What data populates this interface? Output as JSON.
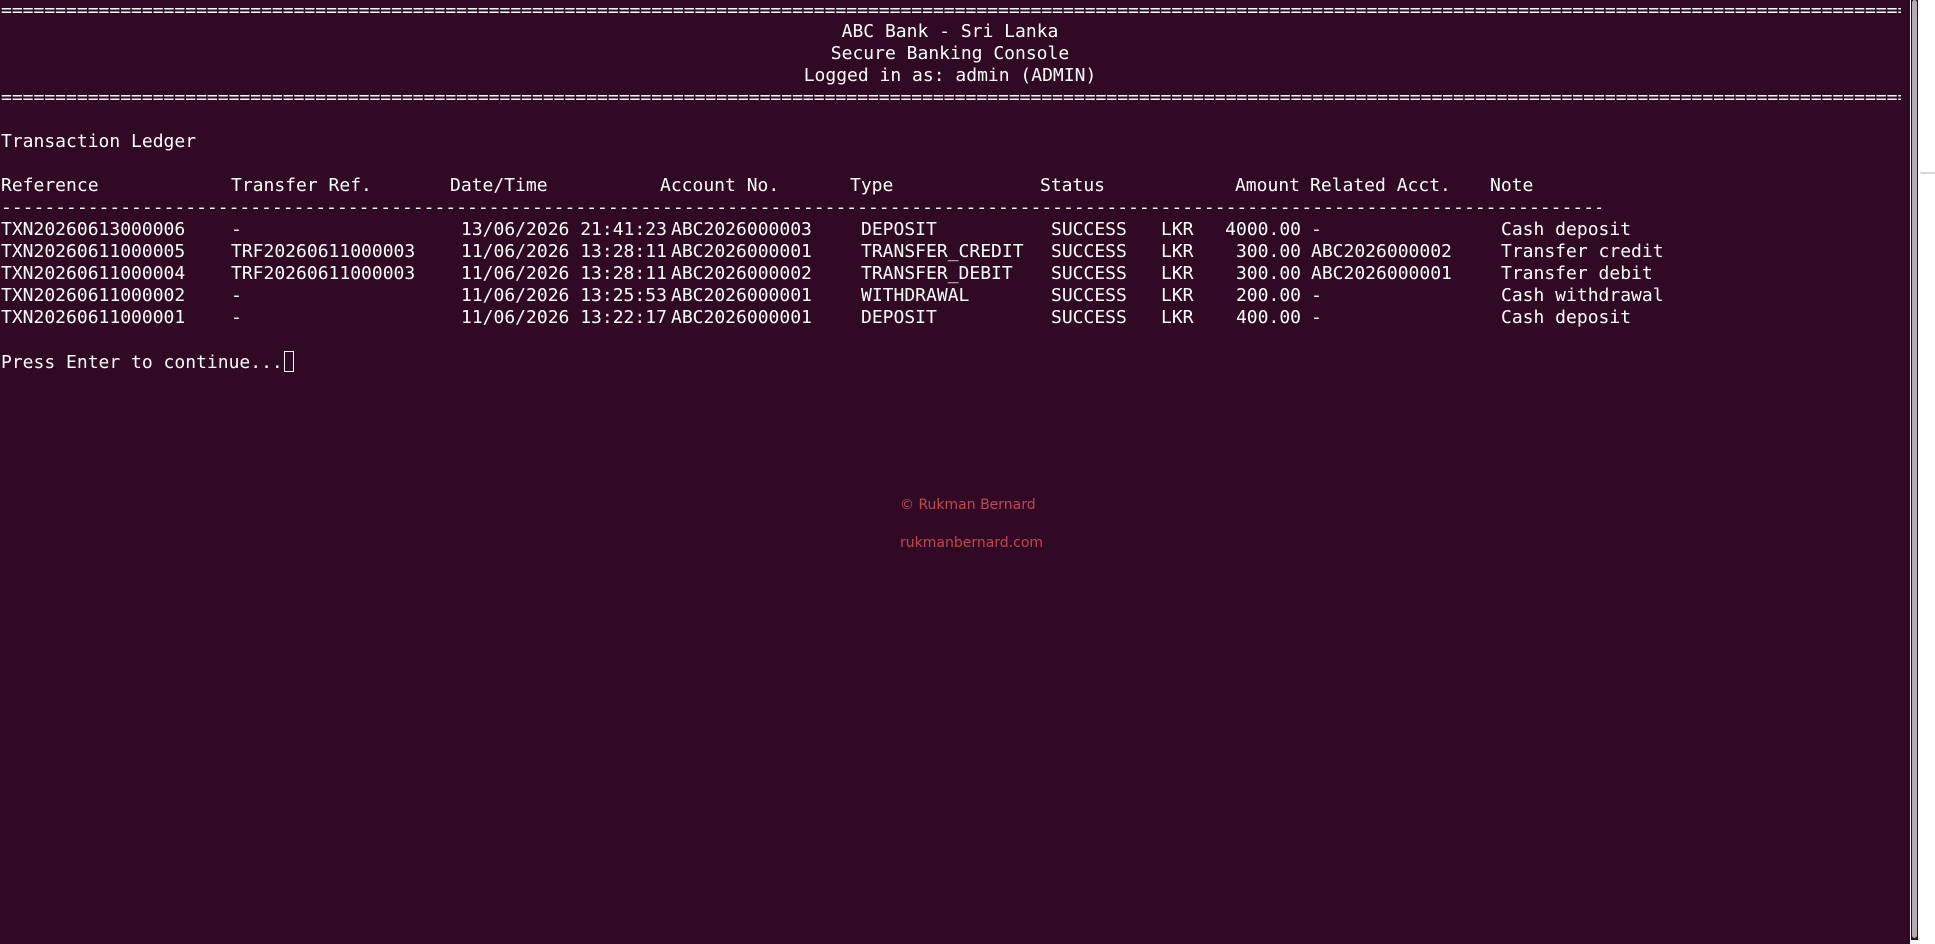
{
  "header": {
    "rule_top": "====================================================================================================================================================================================================",
    "line1": "ABC Bank - Sri Lanka",
    "line2": "Secure Banking Console",
    "line3": "Logged in as: admin (ADMIN)",
    "rule_bottom": "===================================================================================================================================================================================================="
  },
  "ledger": {
    "title": "Transaction Ledger",
    "columns": {
      "reference": "Reference",
      "transfer_ref": "Transfer Ref.",
      "datetime": "Date/Time",
      "account": "Account No.",
      "type": "Type",
      "status": "Status",
      "amount": "Amount",
      "related": "Related Acct.",
      "note": "Note"
    },
    "separator": "-----------------------------------------------------------------------------------------------------------------------------------------------------------------------------------",
    "rows": [
      {
        "reference": "TXN20260613000006",
        "transfer_ref": "-",
        "datetime": "13/06/2026 21:41:23",
        "account": "ABC2026000003",
        "type": "DEPOSIT",
        "status": "SUCCESS",
        "currency": "LKR",
        "amount": "4000.00",
        "related": "-",
        "note": "Cash deposit"
      },
      {
        "reference": "TXN20260611000005",
        "transfer_ref": "TRF20260611000003",
        "datetime": "11/06/2026 13:28:11",
        "account": "ABC2026000001",
        "type": "TRANSFER_CREDIT",
        "status": "SUCCESS",
        "currency": "LKR",
        "amount": "300.00",
        "related": "ABC2026000002",
        "note": "Transfer credit"
      },
      {
        "reference": "TXN20260611000004",
        "transfer_ref": "TRF20260611000003",
        "datetime": "11/06/2026 13:28:11",
        "account": "ABC2026000002",
        "type": "TRANSFER_DEBIT",
        "status": "SUCCESS",
        "currency": "LKR",
        "amount": "300.00",
        "related": "ABC2026000001",
        "note": "Transfer debit"
      },
      {
        "reference": "TXN20260611000002",
        "transfer_ref": "-",
        "datetime": "11/06/2026 13:25:53",
        "account": "ABC2026000001",
        "type": "WITHDRAWAL",
        "status": "SUCCESS",
        "currency": "LKR",
        "amount": "200.00",
        "related": "-",
        "note": "Cash withdrawal"
      },
      {
        "reference": "TXN20260611000001",
        "transfer_ref": "-",
        "datetime": "11/06/2026 13:22:17",
        "account": "ABC2026000001",
        "type": "DEPOSIT",
        "status": "SUCCESS",
        "currency": "LKR",
        "amount": "400.00",
        "related": "-",
        "note": "Cash deposit"
      }
    ]
  },
  "prompt": {
    "text": "Press Enter to continue..."
  },
  "footer": {
    "copyright": "© Rukman Bernard",
    "website": "rukmanbernard.com"
  },
  "colors": {
    "background": "#300a24",
    "foreground": "#ffffff",
    "footer_text": "#c0474c"
  }
}
